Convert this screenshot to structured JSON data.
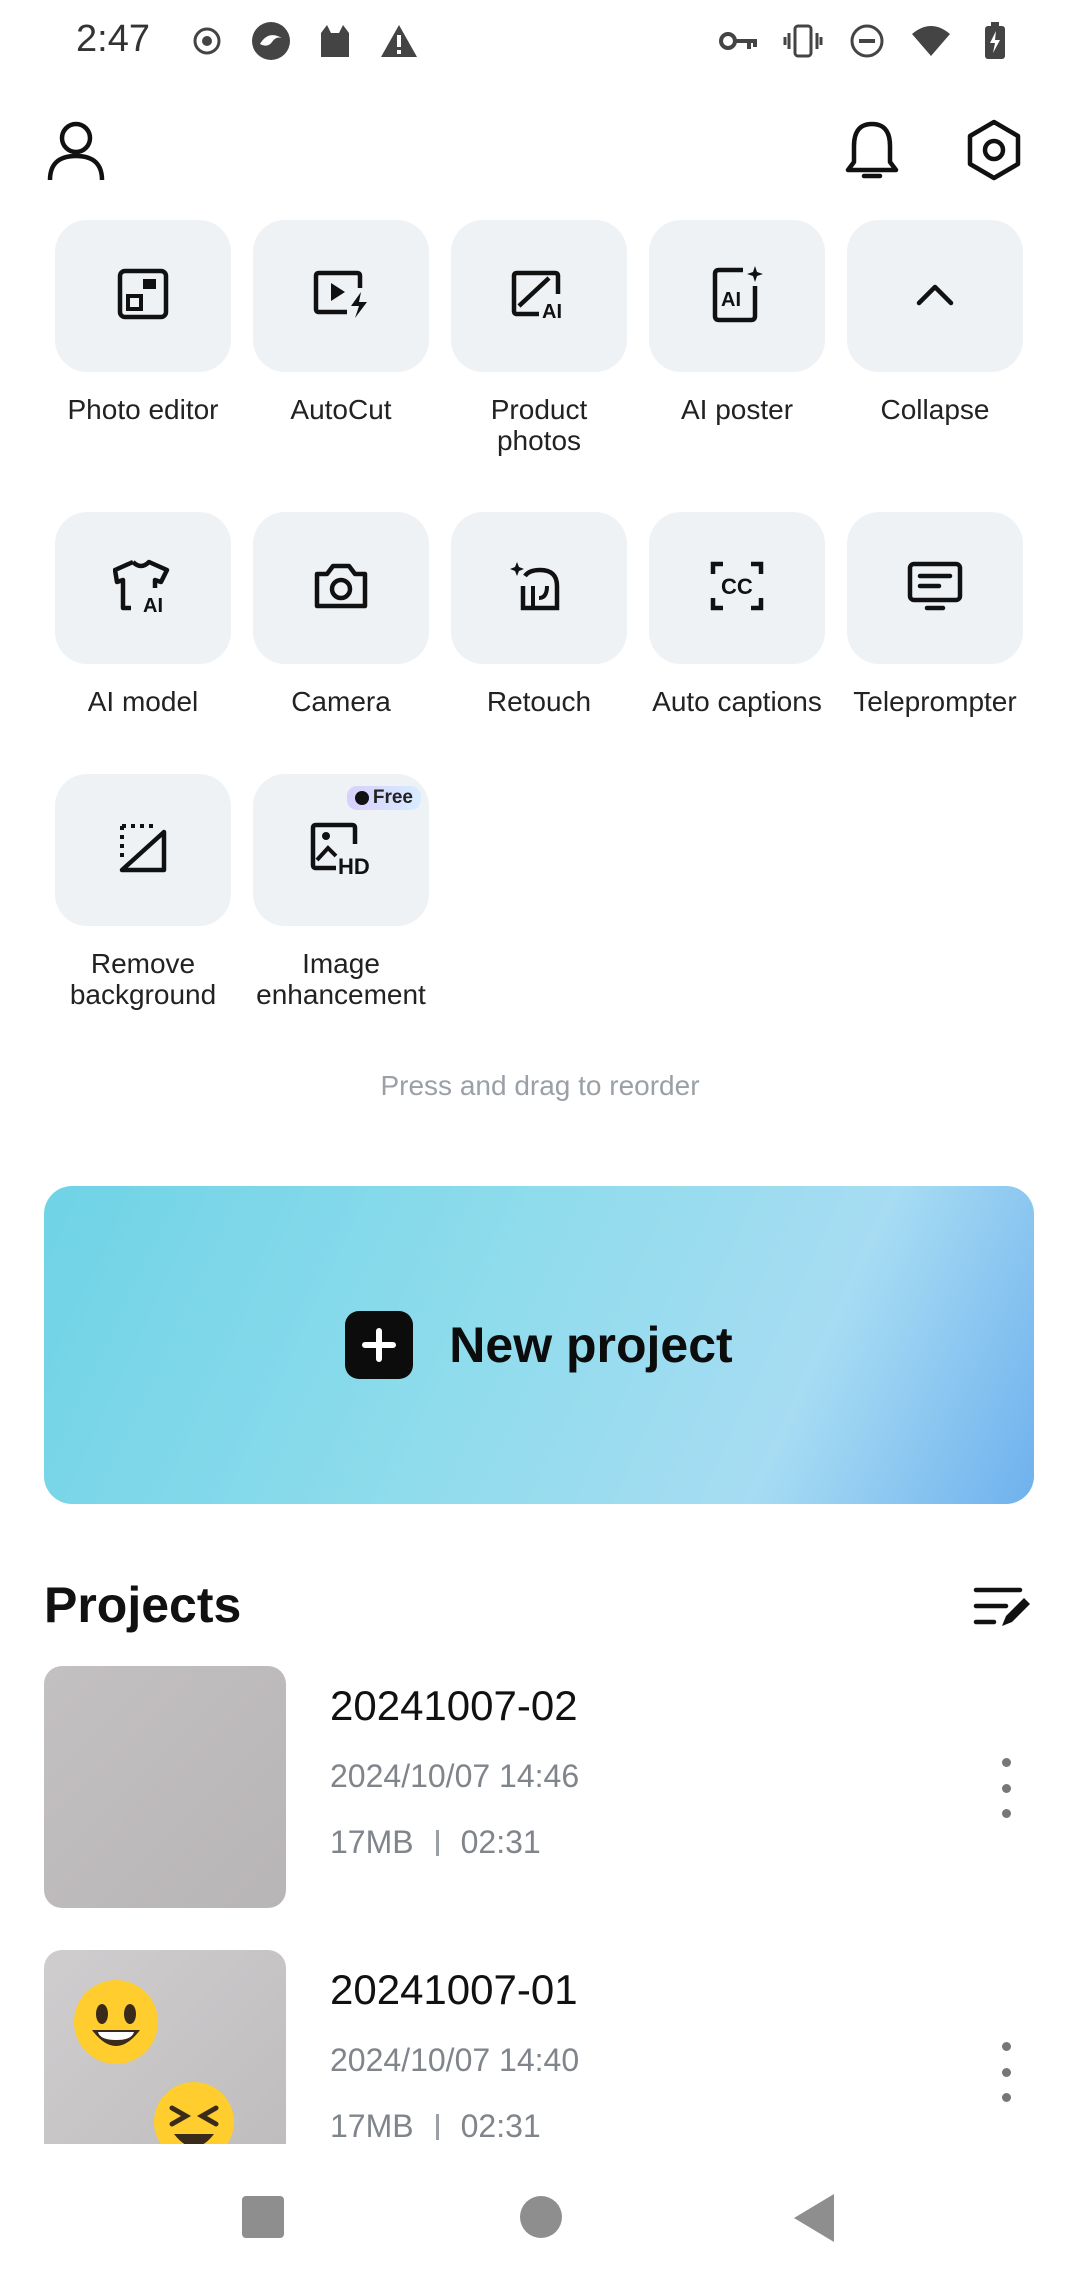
{
  "status_bar": {
    "time": "2:47",
    "left_icons": [
      "record-icon",
      "browser-icon",
      "cat-icon",
      "warning-icon"
    ],
    "right_icons": [
      "key-icon",
      "vibrate-icon",
      "do-not-disturb-icon",
      "wifi-icon",
      "battery-icon"
    ]
  },
  "top_bar": {
    "profile_icon": "profile-icon",
    "notifications_icon": "bell-icon",
    "settings_icon": "settings-icon"
  },
  "tools": [
    {
      "label": "Photo editor",
      "icon": "photo-editor-icon"
    },
    {
      "label": "AutoCut",
      "icon": "autocut-icon"
    },
    {
      "label": "Product\nphotos",
      "icon": "product-photos-icon"
    },
    {
      "label": "AI poster",
      "icon": "ai-poster-icon"
    },
    {
      "label": "Collapse",
      "icon": "chevron-up-icon"
    },
    {
      "label": "AI model",
      "icon": "ai-model-icon"
    },
    {
      "label": "Camera",
      "icon": "camera-icon"
    },
    {
      "label": "Retouch",
      "icon": "retouch-icon"
    },
    {
      "label": "Auto captions",
      "icon": "captions-icon"
    },
    {
      "label": "Teleprompter",
      "icon": "teleprompter-icon"
    },
    {
      "label": "Remove\nbackground",
      "icon": "remove-background-icon"
    },
    {
      "label": "Image\nenhancement",
      "icon": "image-enhancement-icon",
      "badge": "Free"
    }
  ],
  "hint": "Press and drag to reorder",
  "new_project": {
    "label": "New project",
    "icon": "plus-icon"
  },
  "projects": {
    "title": "Projects",
    "sort_icon": "sort-edit-icon",
    "items": [
      {
        "name": "20241007-02",
        "date": "2024/10/07 14:46",
        "size": "17MB",
        "duration": "02:31"
      },
      {
        "name": "20241007-01",
        "date": "2024/10/07 14:40",
        "size": "17MB",
        "duration": "02:31"
      }
    ]
  },
  "nav_bar": {
    "icons": [
      "recents-icon",
      "home-icon",
      "back-icon"
    ]
  },
  "colors": {
    "tile_bg": "#eff2f5",
    "accent_gradient_start": "#6fd3e6",
    "accent_gradient_end": "#6fb1ee",
    "muted_text": "#80858c"
  }
}
